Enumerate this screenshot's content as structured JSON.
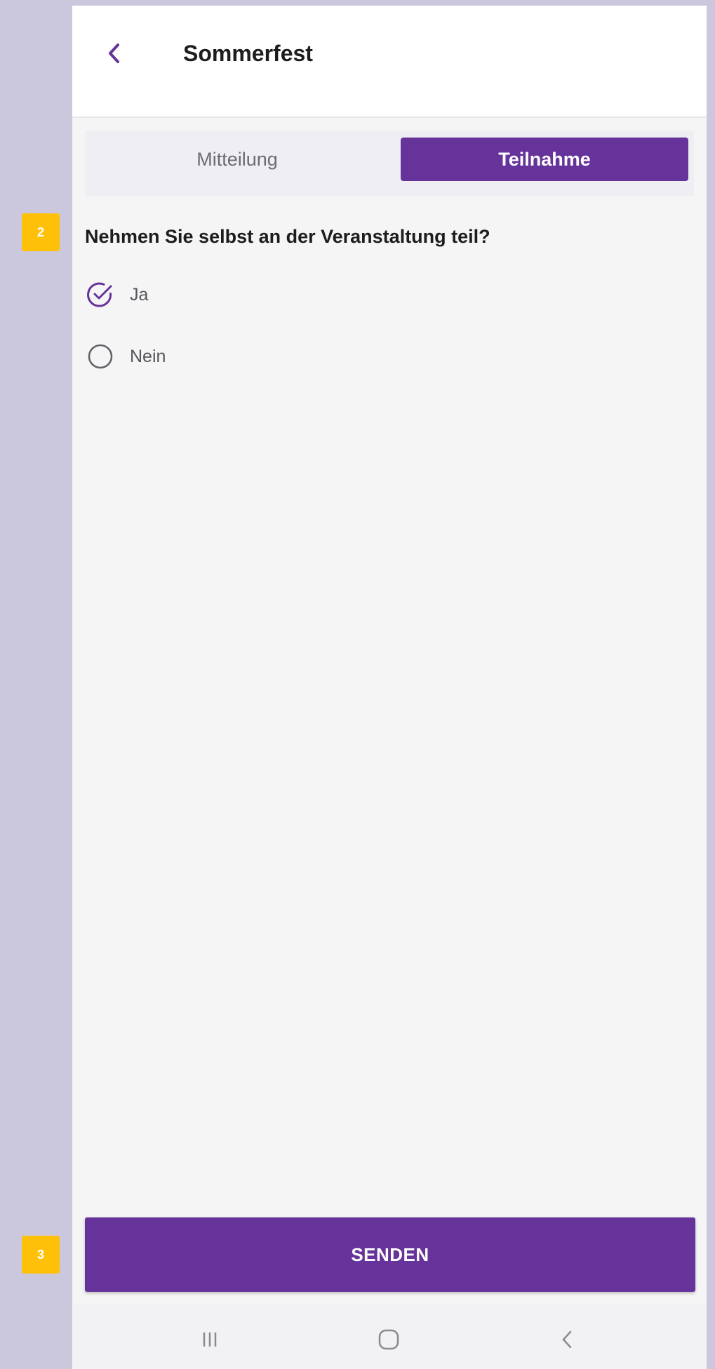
{
  "header": {
    "title": "Sommerfest"
  },
  "tabs": [
    {
      "label": "Mitteilung",
      "active": false
    },
    {
      "label": "Teilnahme",
      "active": true
    }
  ],
  "annotations": {
    "badge_question": "2",
    "badge_send": "3"
  },
  "question": {
    "text": "Nehmen Sie selbst an der Veranstaltung teil?",
    "options": [
      {
        "label": "Ja",
        "selected": true
      },
      {
        "label": "Nein",
        "selected": false
      }
    ]
  },
  "actions": {
    "send_label": "SENDEN"
  },
  "icons": {
    "back": "chevron-left-icon",
    "selected_option": "check-circle-icon",
    "unselected_option": "radio-empty-icon",
    "nav_recents": "recents-icon",
    "nav_home": "home-icon",
    "nav_back": "back-icon"
  },
  "colors": {
    "accent": "#66339a",
    "badge": "#ffc107",
    "background_outer": "#cbc8dd",
    "background_screen": "#f5f5f6"
  }
}
